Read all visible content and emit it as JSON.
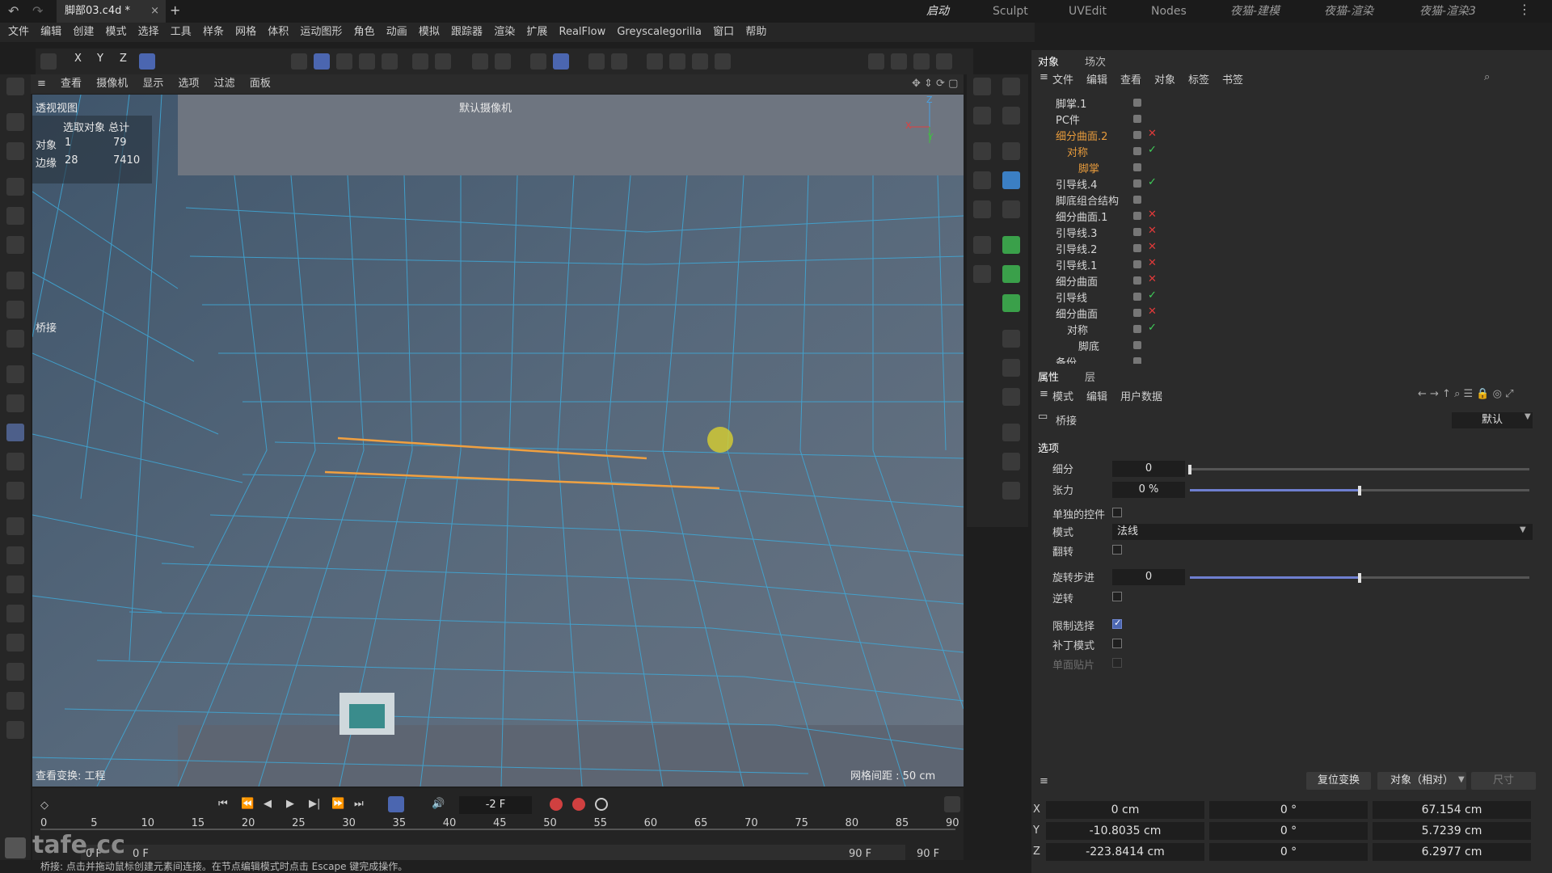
{
  "window": {
    "tab_title": "脚部03.c4d *",
    "tab_close": "×",
    "new_tab": "+",
    "layouts": [
      "启动",
      "Sculpt",
      "UVEdit",
      "Nodes",
      "夜猫-建模",
      "夜猫-渲染",
      "夜猫-渲染3"
    ],
    "active_layout": "启动"
  },
  "menu": [
    "文件",
    "编辑",
    "创建",
    "模式",
    "选择",
    "工具",
    "样条",
    "网格",
    "体积",
    "运动图形",
    "角色",
    "动画",
    "模拟",
    "跟踪器",
    "渲染",
    "扩展",
    "RealFlow",
    "Greyscalegorilla",
    "窗口",
    "帮助"
  ],
  "toolbar": {
    "axis_x": "X",
    "axis_y": "Y",
    "axis_z": "Z"
  },
  "viewport": {
    "menu": [
      "查看",
      "摄像机",
      "显示",
      "选项",
      "过滤",
      "面板"
    ],
    "view_name": "透视视图",
    "camera": "默认摄像机",
    "stats_header": "选取对象 总计",
    "stats_rows": [
      {
        "label": "对象",
        "selected": "1",
        "total": "79"
      },
      {
        "label": "边缘",
        "selected": "28",
        "total": "7410"
      }
    ],
    "tool_label": "桥接",
    "transform_info": "查看变换: 工程",
    "grid_spacing": "网格间距 : 50 cm",
    "watermark": "tafe.cc"
  },
  "timeline": {
    "current_frame": "-2 F",
    "ticks": [
      "0",
      "5",
      "10",
      "15",
      "20",
      "25",
      "30",
      "35",
      "40",
      "45",
      "50",
      "55",
      "60",
      "65",
      "70",
      "75",
      "80",
      "85",
      "90"
    ],
    "start_a": "0 F",
    "start_b": "0 F",
    "end_a": "90 F",
    "end_b": "90 F"
  },
  "status": "桥接: 点击并拖动鼠标创建元素间连接。在节点编辑模式时点击 Escape 键完成操作。",
  "object_manager": {
    "tabs": [
      "对象",
      "场次"
    ],
    "menu": [
      "文件",
      "编辑",
      "查看",
      "对象",
      "标签",
      "书签"
    ],
    "objects": [
      {
        "name": "脚掌.1",
        "indent": 0,
        "flag": "",
        "color": "normal"
      },
      {
        "name": "PC件",
        "indent": 0,
        "flag": "",
        "color": "normal"
      },
      {
        "name": "细分曲面.2",
        "indent": 0,
        "flag": "✕",
        "flag_color": "red",
        "color": "orange"
      },
      {
        "name": "对称",
        "indent": 1,
        "flag": "✓",
        "flag_color": "green",
        "color": "orange"
      },
      {
        "name": "脚掌",
        "indent": 2,
        "flag": "",
        "color": "orange"
      },
      {
        "name": "引导线.4",
        "indent": 0,
        "flag": "✓",
        "flag_color": "green",
        "color": "normal"
      },
      {
        "name": "脚底组合结构",
        "indent": 0,
        "flag": "",
        "color": "normal"
      },
      {
        "name": "细分曲面.1",
        "indent": 0,
        "flag": "✕",
        "flag_color": "red",
        "color": "normal"
      },
      {
        "name": "引导线.3",
        "indent": 0,
        "flag": "✕",
        "flag_color": "red",
        "color": "normal"
      },
      {
        "name": "引导线.2",
        "indent": 0,
        "flag": "✕",
        "flag_color": "red",
        "color": "normal"
      },
      {
        "name": "引导线.1",
        "indent": 0,
        "flag": "✕",
        "flag_color": "red",
        "color": "normal"
      },
      {
        "name": "细分曲面",
        "indent": 0,
        "flag": "✕",
        "flag_color": "red",
        "color": "normal"
      },
      {
        "name": "引导线",
        "indent": 0,
        "flag": "✓",
        "flag_color": "green",
        "color": "normal"
      },
      {
        "name": "细分曲面",
        "indent": 0,
        "flag": "✕",
        "flag_color": "red",
        "color": "normal"
      },
      {
        "name": "对称",
        "indent": 1,
        "flag": "✓",
        "flag_color": "green",
        "color": "normal"
      },
      {
        "name": "脚底",
        "indent": 2,
        "flag": "",
        "color": "normal"
      },
      {
        "name": "备份",
        "indent": 0,
        "flag": "",
        "color": "normal"
      }
    ]
  },
  "attributes": {
    "tabs": [
      "属性",
      "层"
    ],
    "menu": [
      "模式",
      "编辑",
      "用户数据"
    ],
    "tool_name": "桥接",
    "preset": "默认",
    "section": "选项",
    "subdivision_label": "细分",
    "subdivision_value": "0",
    "subdivision_fraction": 0.0,
    "tension_label": "张力",
    "tension_value": "0 %",
    "tension_fraction": 0.5,
    "separate_label": "单独的控件",
    "separate_checked": false,
    "mode_label": "模式",
    "mode_value": "法线",
    "flip_label": "翻转",
    "flip_checked": false,
    "rotate_label": "旋转步进",
    "rotate_value": "0",
    "rotate_fraction": 0.5,
    "reverse_label": "逆转",
    "reverse_checked": false,
    "limit_label": "限制选择",
    "limit_checked": true,
    "patch_label": "补丁模式",
    "patch_checked": false,
    "single_label": "单面贴片",
    "single_checked": false
  },
  "coordinates": {
    "reset_button": "复位变换",
    "mode": "对象（相对）",
    "size_mode": "尺寸",
    "rows": [
      {
        "axis": "X",
        "pos": "0 cm",
        "rot": "0 °",
        "size": "67.154 cm"
      },
      {
        "axis": "Y",
        "pos": "-10.8035 cm",
        "rot": "0 °",
        "size": "5.7239 cm"
      },
      {
        "axis": "Z",
        "pos": "-223.8414 cm",
        "rot": "0 °",
        "size": "6.2977 cm"
      }
    ]
  },
  "colors": {
    "accent": "#4b66b0",
    "selection_edge": "#f0a040",
    "mesh_wire": "#3fa9d8"
  }
}
